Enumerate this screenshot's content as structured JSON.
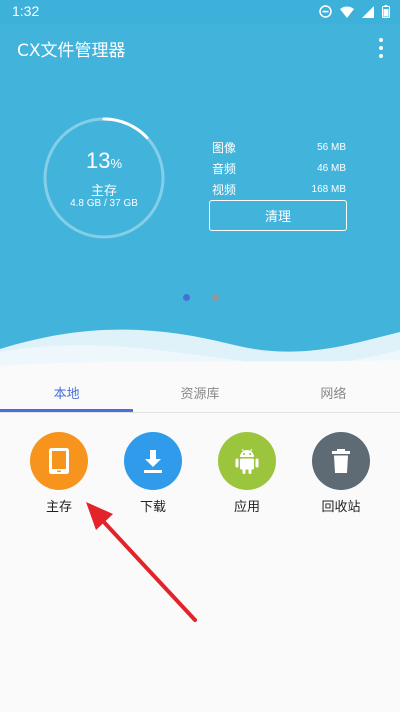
{
  "status": {
    "time": "1:32"
  },
  "app": {
    "title": "CX文件管理器"
  },
  "storage": {
    "percent": "13",
    "percent_symbol": "%",
    "percent_value": 0.13,
    "label": "主存",
    "usage": "4.8 GB / 37 GB"
  },
  "stats": [
    {
      "name": "图像",
      "value": "56 MB"
    },
    {
      "name": "音频",
      "value": "46 MB"
    },
    {
      "name": "视频",
      "value": "168 MB"
    }
  ],
  "clean_label": "清理",
  "pager": {
    "active_index": 0,
    "count": 2
  },
  "tabs": [
    {
      "label": "本地",
      "active": true
    },
    {
      "label": "资源库",
      "active": false
    },
    {
      "label": "网络",
      "active": false
    }
  ],
  "locations": [
    {
      "label": "主存",
      "icon": "tablet-icon",
      "color": "#f7941d"
    },
    {
      "label": "下载",
      "icon": "download-icon",
      "color": "#2f9bea"
    },
    {
      "label": "应用",
      "icon": "android-icon",
      "color": "#9bc53d"
    },
    {
      "label": "回收站",
      "icon": "trash-icon",
      "color": "#5e6b75"
    }
  ],
  "colors": {
    "header": "#42b4dc",
    "accent": "#4a6fd8",
    "annotation_arrow": "#e2232a"
  }
}
